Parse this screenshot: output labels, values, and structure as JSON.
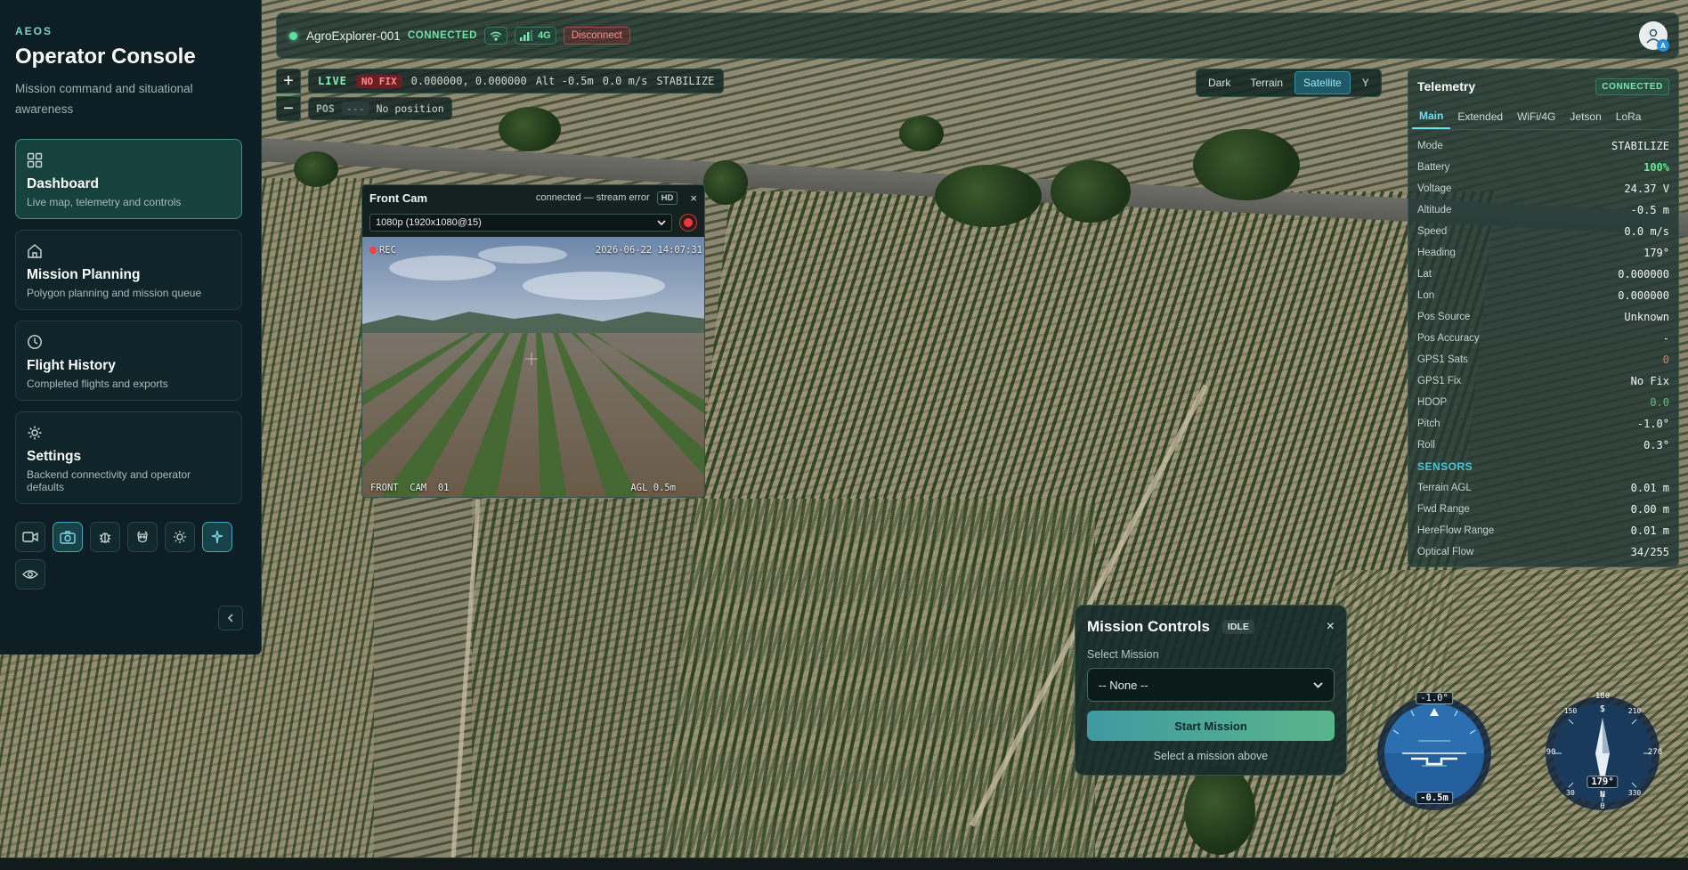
{
  "sidebar": {
    "brand": "AEOS",
    "title": "Operator Console",
    "subtitle": "Mission command and situational awareness",
    "items": [
      {
        "label": "Dashboard",
        "desc": "Live map, telemetry and controls",
        "icon": "dashboard-icon",
        "active": true
      },
      {
        "label": "Mission Planning",
        "desc": "Polygon planning and mission queue",
        "icon": "home-icon"
      },
      {
        "label": "Flight History",
        "desc": "Completed flights and exports",
        "icon": "clock-icon"
      },
      {
        "label": "Settings",
        "desc": "Backend connectivity and operator defaults",
        "icon": "gear-icon"
      }
    ],
    "tools": [
      "video-icon",
      "camera-icon",
      "bug-icon",
      "robot-icon",
      "sun-icon",
      "pin-icon",
      "eye-icon"
    ]
  },
  "topbar": {
    "vehicle": "AgroExplorer-001",
    "status": "CONNECTED",
    "network": "4G",
    "disconnect": "Disconnect",
    "avatar_badge": "A"
  },
  "map": {
    "zoom_in": "+",
    "zoom_out": "−",
    "live": "LIVE",
    "fix": "NO FIX",
    "coords": "0.000000, 0.000000",
    "alt": "Alt -0.5m",
    "speed": "0.0 m/s",
    "mode": "STABILIZE",
    "pos_label": "POS",
    "pos_tag": "---",
    "pos_text": "No position",
    "layers": [
      "Dark",
      "Terrain",
      "Satellite"
    ],
    "selected_layer": "Satellite",
    "layer_menu": "Y"
  },
  "camera": {
    "title": "Front Cam",
    "status": "connected — stream error",
    "quality": "HD",
    "close": "×",
    "resolution": "1080p (1920x1080@15)",
    "rec": "REC",
    "timestamp": "2026-06-22 14:07:31",
    "cam_id": "FRONT  CAM  01",
    "agl": "AGL 0.5m"
  },
  "telemetry": {
    "title": "Telemetry",
    "status": "CONNECTED",
    "tabs": [
      "Main",
      "Extended",
      "WiFi/4G",
      "Jetson",
      "LoRa"
    ],
    "rows": [
      {
        "k": "Mode",
        "v": "STABILIZE"
      },
      {
        "k": "Battery",
        "v": "100%"
      },
      {
        "k": "Voltage",
        "v": "24.37 V"
      },
      {
        "k": "Altitude",
        "v": "-0.5 m"
      },
      {
        "k": "Speed",
        "v": "0.0 m/s"
      },
      {
        "k": "Heading",
        "v": "179°"
      },
      {
        "k": "Lat",
        "v": "0.000000"
      },
      {
        "k": "Lon",
        "v": "0.000000"
      },
      {
        "k": "Pos Source",
        "v": "Unknown"
      },
      {
        "k": "Pos Accuracy",
        "v": "-"
      },
      {
        "k": "GPS1 Sats",
        "v": "0"
      },
      {
        "k": "GPS1 Fix",
        "v": "No Fix"
      },
      {
        "k": "HDOP",
        "v": "0.0"
      },
      {
        "k": "Pitch",
        "v": "-1.0°"
      },
      {
        "k": "Roll",
        "v": "0.3°"
      }
    ],
    "sensors_label": "SENSORS",
    "sensors": [
      {
        "k": "Terrain AGL",
        "v": "0.01 m"
      },
      {
        "k": "Fwd Range",
        "v": "0.00 m"
      },
      {
        "k": "HereFlow Range",
        "v": "0.01 m"
      },
      {
        "k": "Optical Flow",
        "v": "34/255"
      }
    ],
    "colors": {
      "battery": "#6ee88f",
      "sats": "#ff6b5e",
      "hdop": "#5fbf6e"
    }
  },
  "mission": {
    "title": "Mission Controls",
    "state": "IDLE",
    "close": "×",
    "select_label": "Select Mission",
    "selected": "-- None --",
    "start": "Start Mission",
    "hint": "Select a mission above"
  },
  "instruments": {
    "pitch": "-1.0°",
    "alt": "-0.5m",
    "heading": "179°",
    "compass_n": "N",
    "compass_s": "S",
    "heading_ticks": [
      "180",
      "210",
      "150",
      "270",
      "90",
      "330",
      "30",
      "0"
    ]
  }
}
